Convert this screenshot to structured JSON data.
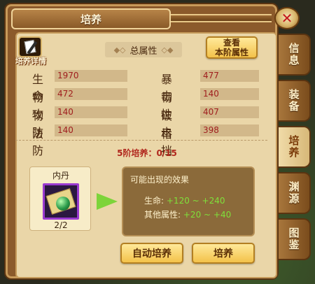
{
  "window": {
    "title": "培养"
  },
  "detail": {
    "label": "培养详情"
  },
  "section": {
    "title": "总属性"
  },
  "stage_button": {
    "line1": "查看",
    "line2": "本阶属性"
  },
  "stats": [
    {
      "label": "生命",
      "value": "1970"
    },
    {
      "label": "暴击",
      "value": "477"
    },
    {
      "label": "物攻",
      "value": "472"
    },
    {
      "label": "韧性",
      "value": "140"
    },
    {
      "label": "物防",
      "value": "140"
    },
    {
      "label": "破击",
      "value": "407"
    },
    {
      "label": "法防",
      "value": "140"
    },
    {
      "label": "格挡",
      "value": "398"
    }
  ],
  "training": {
    "progress": "5阶培养：0/15"
  },
  "item": {
    "name": "内丹",
    "count": "2/2"
  },
  "effects": {
    "title": "可能出现的效果",
    "line1_label": "生命:",
    "line1_value": "+120 ~ +240",
    "line2_label": "其他属性:",
    "line2_value": "+20 ~ +40"
  },
  "buttons": {
    "auto_train": "自动培养",
    "train": "培养"
  },
  "tabs": [
    {
      "label": "信息",
      "active": false
    },
    {
      "label": "装备",
      "active": false
    },
    {
      "label": "培养",
      "active": true
    },
    {
      "label": "渊源",
      "active": false
    },
    {
      "label": "图鉴",
      "active": false
    }
  ],
  "colors": {
    "accent_red": "#a01e1e",
    "positive_green": "#7fe03a",
    "panel": "#ead6a8"
  }
}
